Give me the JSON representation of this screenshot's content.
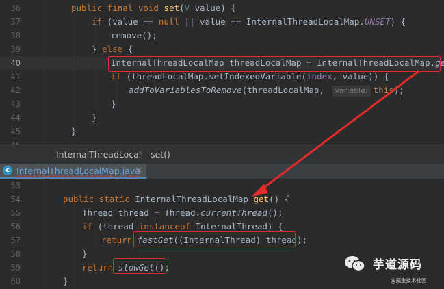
{
  "top_pane": {
    "lines": [
      {
        "no": "36",
        "current": false,
        "tokens": [
          [
            "kw",
            "public "
          ],
          [
            "kw",
            "final "
          ],
          [
            "kw",
            "void "
          ],
          [
            "fn",
            "set"
          ],
          [
            "ty",
            "("
          ],
          [
            "tp",
            "V"
          ],
          [
            "ty",
            " value) {"
          ]
        ]
      },
      {
        "no": "37",
        "current": false,
        "tokens": [
          [
            "kw",
            "if "
          ],
          [
            "ty",
            "(value == "
          ],
          [
            "kw",
            "null "
          ],
          [
            "ty",
            "|| value == InternalThreadLocalMap."
          ],
          [
            "it",
            "UNSET"
          ],
          [
            "ty",
            ") {"
          ]
        ]
      },
      {
        "no": "38",
        "current": false,
        "tokens": [
          [
            "ty",
            "remove();"
          ]
        ]
      },
      {
        "no": "39",
        "current": false,
        "tokens": [
          [
            "ty",
            "} "
          ],
          [
            "kw",
            "else "
          ],
          [
            "ty",
            "{"
          ]
        ]
      },
      {
        "no": "40",
        "current": true,
        "tokens": [
          [
            "ty",
            "InternalThreadLocalMap threadLocalMap = InternalThreadLocalMap."
          ],
          [
            "st",
            "get"
          ],
          [
            "ty",
            "();"
          ]
        ]
      },
      {
        "no": "41",
        "current": false,
        "tokens": [
          [
            "kw",
            "if "
          ],
          [
            "ty",
            "(threadLocalMap.setIndexedVariable("
          ],
          [
            "it2",
            "index"
          ],
          [
            "ty",
            ", value)) {"
          ]
        ]
      },
      {
        "no": "42",
        "current": false,
        "tokens": [
          [
            "fnit",
            "addToVariablesToRemove"
          ],
          [
            "ty",
            "(threadLocalMap, "
          ],
          [
            "hint",
            "variable:"
          ],
          [
            "kw",
            "this"
          ],
          [
            "ty",
            ");"
          ]
        ]
      },
      {
        "no": "43",
        "current": false,
        "tokens": [
          [
            "ty",
            "}"
          ]
        ]
      },
      {
        "no": "44",
        "current": false,
        "tokens": [
          [
            "ty",
            "}"
          ]
        ]
      },
      {
        "no": "45",
        "current": false,
        "tokens": [
          [
            "ty",
            "}"
          ]
        ]
      },
      {
        "no": "46",
        "current": false,
        "tokens": []
      }
    ]
  },
  "breadcrumb": {
    "items": [
      "InternalThreadLocal",
      "set()"
    ],
    "separator": "›"
  },
  "tab": {
    "icon_letter": "c",
    "label": "InternalThreadLocalMap.java",
    "close": "×"
  },
  "bottom_pane": {
    "lines": [
      {
        "no": "53",
        "tokens": []
      },
      {
        "no": "54",
        "tokens": [
          [
            "kw",
            "public "
          ],
          [
            "kw",
            "static "
          ],
          [
            "ty",
            "InternalThreadLocalMap "
          ],
          [
            "fn",
            "get"
          ],
          [
            "ty",
            "() {"
          ]
        ]
      },
      {
        "no": "55",
        "tokens": [
          [
            "ty",
            "Thread thread = Thread."
          ],
          [
            "st",
            "currentThread"
          ],
          [
            "ty",
            "();"
          ]
        ]
      },
      {
        "no": "56",
        "tokens": [
          [
            "kw",
            "if "
          ],
          [
            "ty",
            "(thread "
          ],
          [
            "kw",
            "instanceof "
          ],
          [
            "ty",
            "InternalThread) {"
          ]
        ]
      },
      {
        "no": "57",
        "tokens": [
          [
            "kw",
            "return "
          ],
          [
            "st",
            "fastGet"
          ],
          [
            "ty",
            "((InternalThread) thread);"
          ]
        ]
      },
      {
        "no": "58",
        "tokens": [
          [
            "ty",
            "}"
          ]
        ]
      },
      {
        "no": "59",
        "tokens": [
          [
            "kw",
            "return "
          ],
          [
            "st",
            "slowGet"
          ],
          [
            "ty",
            "();"
          ]
        ]
      },
      {
        "no": "60",
        "tokens": [
          [
            "ty",
            "}"
          ]
        ]
      }
    ]
  },
  "watermark": {
    "title": "芋道源码",
    "subtitle": "@掘金技术社区"
  },
  "colors": {
    "background": "#2b2b2b",
    "keyword": "#cc7832",
    "method_decl": "#ffc66d",
    "highlight_box": "#e32b2b",
    "arrow": "#e32b2b"
  }
}
